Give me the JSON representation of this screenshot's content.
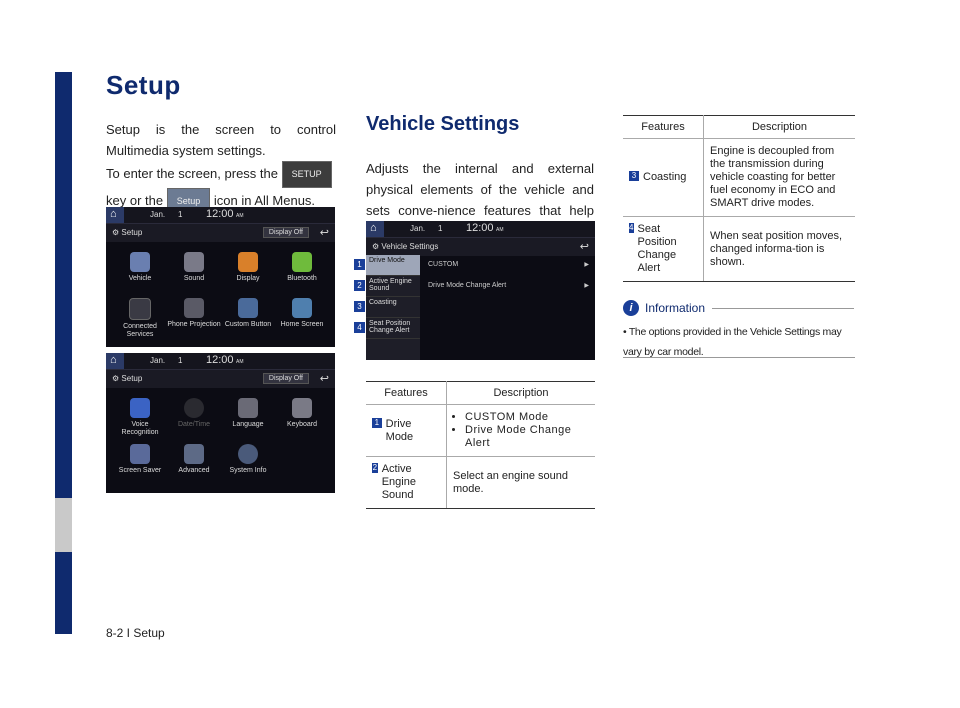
{
  "page": {
    "title": "Setup",
    "footer": "8-2 I Setup"
  },
  "intro": {
    "para1": "Setup is the screen to control Multimedia system settings.",
    "para2_a": "To enter the screen, press the",
    "key_chip": "SETUP",
    "para2_b": "key or the",
    "icon_chip": "Setup",
    "para2_c": "icon in All Menus."
  },
  "screen1": {
    "month": "Jan.",
    "day": "1",
    "clock": "12:00",
    "ampm": "AM",
    "title": "Setup",
    "display_off": "Display Off",
    "tiles": [
      "Vehicle",
      "Sound",
      "Display",
      "Bluetooth",
      "Connected Services",
      "Phone Projection",
      "Custom Button",
      "Home Screen"
    ]
  },
  "screen2": {
    "month": "Jan.",
    "day": "1",
    "clock": "12:00",
    "ampm": "AM",
    "title": "Setup",
    "display_off": "Display Off",
    "tiles": [
      "Voice Recognition",
      "Date/Time",
      "Language",
      "Keyboard",
      "Screen Saver",
      "Advanced",
      "System Info"
    ]
  },
  "vehicle": {
    "section_title": "Vehicle Settings",
    "desc": "Adjusts the internal and external physical elements of the vehicle and sets conve-nience features that help with driving.",
    "screen": {
      "month": "Jan.",
      "day": "1",
      "clock": "12:00",
      "ampm": "AM",
      "title": "Vehicle Settings",
      "menu": [
        "Drive Mode",
        "Active Engine Sound",
        "Coasting",
        "Seat Position Change Alert"
      ],
      "rows": [
        "CUSTOM",
        "Drive Mode Change Alert"
      ]
    },
    "callouts": [
      "1",
      "2",
      "3",
      "4"
    ]
  },
  "table1": {
    "headers": [
      "Features",
      "Description"
    ],
    "rows": [
      {
        "num": "1",
        "feature": "Drive Mode",
        "bullets": [
          "CUSTOM Mode",
          "Drive Mode Change Alert"
        ]
      },
      {
        "num": "2",
        "feature": "Active Engine Sound",
        "desc": "Select an engine sound mode."
      }
    ]
  },
  "table2": {
    "headers": [
      "Features",
      "Description"
    ],
    "rows": [
      {
        "num": "3",
        "feature": "Coasting",
        "desc": "Engine is decoupled from the transmission during vehicle coasting for better fuel economy in ECO and SMART drive modes."
      },
      {
        "num": "4",
        "feature": "Seat Position Change Alert",
        "desc": "When seat position moves, changed informa-tion is shown."
      }
    ]
  },
  "info": {
    "title": "Information",
    "bullet": "The options provided in the Vehicle Settings may vary by car model."
  }
}
